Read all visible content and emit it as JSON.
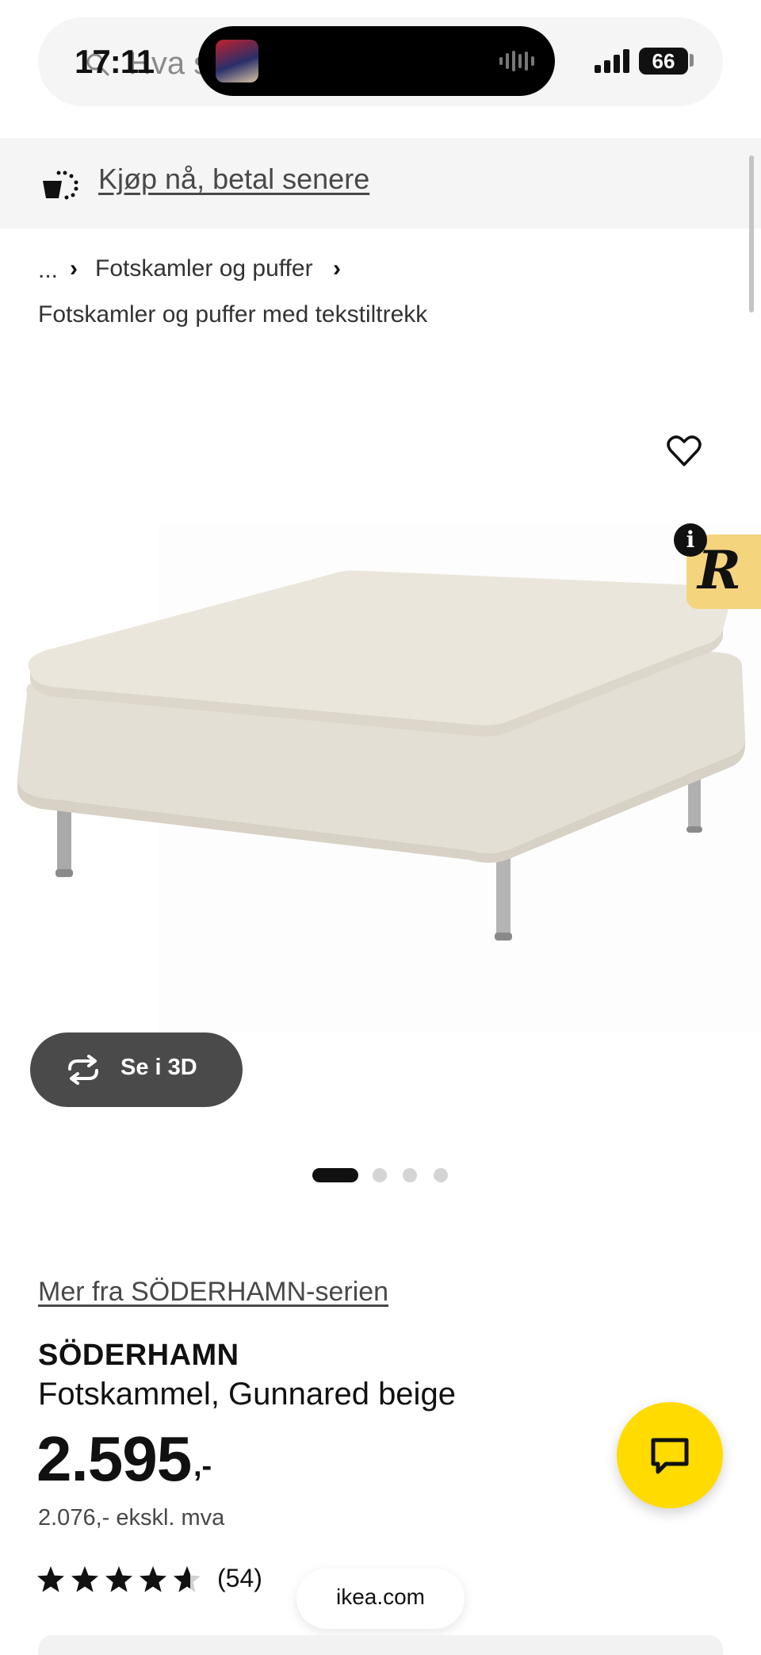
{
  "status_bar": {
    "time": "17:11",
    "battery": "66"
  },
  "search": {
    "placeholder": "Hva s"
  },
  "banner": {
    "link": "Kjøp nå, betal senere"
  },
  "breadcrumb": {
    "ellipsis": "...",
    "category": "Fotskamler og puffer",
    "subcategory": "Fotskamler og puffer med tekstiltrekk"
  },
  "gallery": {
    "view_3d_label": "Se i 3D",
    "image_count": 4,
    "active_index": 0
  },
  "badge": {
    "info": "i",
    "letter": "R"
  },
  "product": {
    "series_link": "Mer fra SÖDERHAMN-serien",
    "name": "SÖDERHAMN",
    "description": "Fotskammel, Gunnared beige",
    "price": "2.595",
    "price_suffix": ",-",
    "price_ex_vat": "2.076,- ekskl. mva",
    "rating": 4.6,
    "review_count": "(54)"
  },
  "browser": {
    "url": "ikea.com"
  },
  "colors": {
    "accent_yellow": "#ffdb00",
    "banner_bg": "#f5f5f5",
    "button_dark": "#4a4a4a",
    "badge_yellow": "#f5d47e"
  }
}
